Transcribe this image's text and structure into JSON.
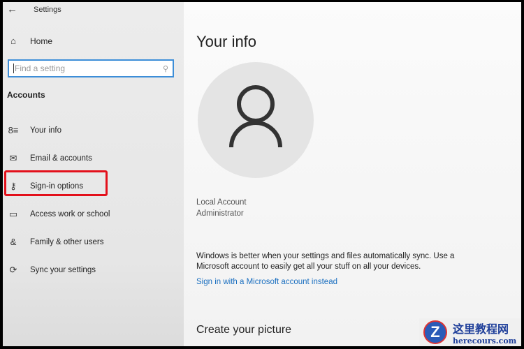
{
  "window": {
    "title": "Settings"
  },
  "sidebar": {
    "home": "Home",
    "search_placeholder": "Find a setting",
    "section": "Accounts",
    "items": [
      {
        "label": "Your info",
        "icon": "person-list-icon"
      },
      {
        "label": "Email & accounts",
        "icon": "mail-icon"
      },
      {
        "label": "Sign-in options",
        "icon": "key-icon"
      },
      {
        "label": "Access work or school",
        "icon": "briefcase-icon"
      },
      {
        "label": "Family & other users",
        "icon": "people-icon"
      },
      {
        "label": "Sync your settings",
        "icon": "sync-icon"
      }
    ]
  },
  "main": {
    "title": "Your info",
    "account_type": "Local Account",
    "role": "Administrator",
    "sync_text": "Windows is better when your settings and files automatically sync. Use a Microsoft account to easily get all your stuff on all your devices.",
    "ms_link": "Sign in with a Microsoft account instead",
    "picture_heading": "Create your picture"
  },
  "watermark": {
    "cn": "这里教程网",
    "url": "herecours.com"
  },
  "colors": {
    "highlight": "#e3101b",
    "link": "#1a6fc0",
    "focus": "#3d8ed8"
  }
}
